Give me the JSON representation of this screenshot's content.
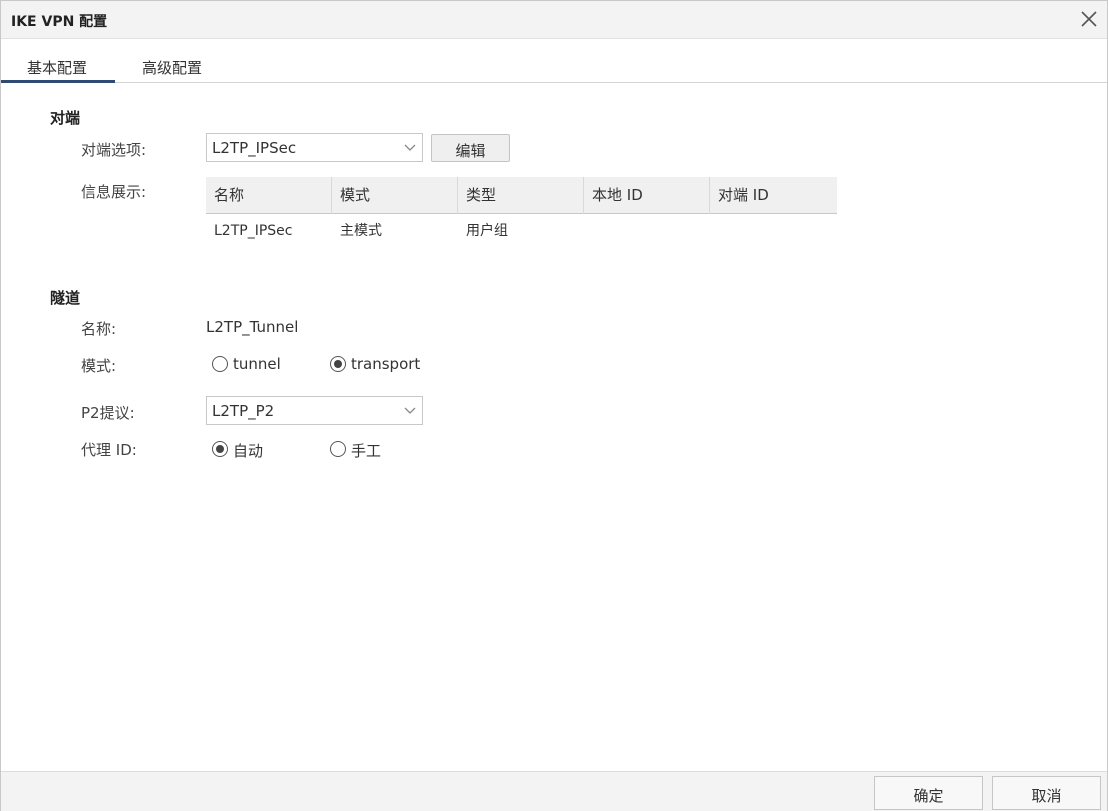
{
  "window": {
    "title": "IKE VPN 配置"
  },
  "tabs": [
    {
      "label": "基本配置",
      "active": true
    },
    {
      "label": "高级配置",
      "active": false
    }
  ],
  "peer": {
    "section_title": "对端",
    "option_label": "对端选项:",
    "option_value": "L2TP_IPSec",
    "edit_label": "编辑",
    "info_label": "信息展示:",
    "table": {
      "headers": [
        "名称",
        "模式",
        "类型",
        "本地 ID",
        "对端 ID"
      ],
      "rows": [
        [
          "L2TP_IPSec",
          "主模式",
          "用户组",
          "",
          ""
        ]
      ]
    }
  },
  "tunnel": {
    "section_title": "隧道",
    "name_label": "名称:",
    "name_value": "L2TP_Tunnel",
    "mode_label": "模式:",
    "mode_options": [
      {
        "label": "tunnel",
        "selected": false
      },
      {
        "label": "transport",
        "selected": true
      }
    ],
    "p2_label": "P2提议:",
    "p2_value": "L2TP_P2",
    "proxy_label": "代理 ID:",
    "proxy_options": [
      {
        "label": "自动",
        "selected": true
      },
      {
        "label": "手工",
        "selected": false
      }
    ]
  },
  "footer": {
    "ok_label": "确定",
    "cancel_label": "取消"
  },
  "colors": {
    "tab_accent": "#2f4b73",
    "header_bg": "#f3f3f3"
  }
}
